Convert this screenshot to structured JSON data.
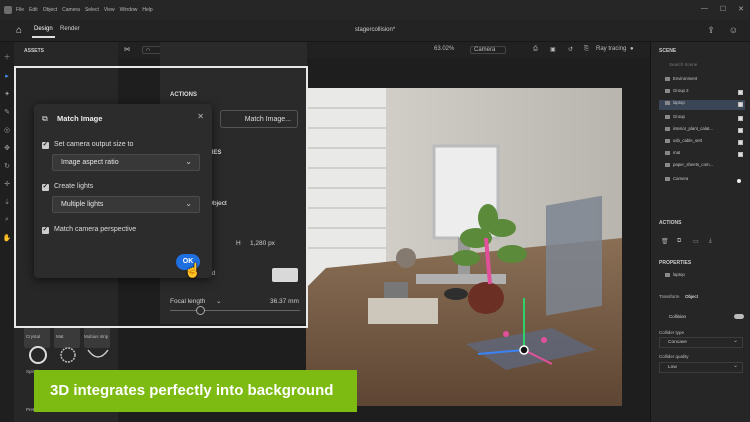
{
  "menubar": {
    "items": [
      "File",
      "Edit",
      "Object",
      "Camera",
      "Select",
      "View",
      "Window",
      "Help"
    ],
    "window_controls": [
      "—",
      "☐",
      "✕"
    ]
  },
  "topbar": {
    "tabs": [
      "Design",
      "Render"
    ],
    "doc_title": "stagercollision*",
    "right_icons": [
      "share-icon",
      "user-icon"
    ]
  },
  "assets": {
    "header": "ASSETS",
    "items": [
      "Crystal",
      "Mat",
      "Mobius strip",
      "Spiral",
      "Pretzel"
    ]
  },
  "viewport_bar": {
    "zoom": "63.02%",
    "camera": "Camera",
    "ray_tracing": "Ray tracing"
  },
  "properties": {
    "actions_header": "ACTIONS",
    "match_image_button": "Match Image...",
    "partial_header": "TIES",
    "object_tab": "Object",
    "height_label": "H",
    "height_value": "1,280 px",
    "partial_label": "nd",
    "focal_length_label": "Focal length",
    "focal_length_value": "36.37 mm"
  },
  "dialog": {
    "title": "Match Image",
    "set_camera_label": "Set camera output size to",
    "set_camera_value": "Image aspect ratio",
    "create_lights_label": "Create lights",
    "create_lights_value": "Multiple lights",
    "match_perspective_label": "Match camera perspective",
    "ok_label": "OK"
  },
  "scene": {
    "header": "SCENE",
    "search_placeholder": "Search Scene",
    "items": [
      {
        "label": "Environment",
        "selected": false
      },
      {
        "label": "Group 2",
        "selected": false
      },
      {
        "label": "laptop",
        "selected": true
      },
      {
        "label": "Group",
        "selected": false
      },
      {
        "label": "interior_plant_calat...",
        "selected": false
      },
      {
        "label": "usb_cable_sett",
        "selected": false
      },
      {
        "label": "mat",
        "selected": false
      },
      {
        "label": "paper_sheets_com...",
        "selected": false
      },
      {
        "label": "Camera",
        "selected": false
      }
    ],
    "actions_header": "ACTIONS",
    "properties_header": "PROPERTIES",
    "selected_object": "laptop",
    "transform_tab": "Transform",
    "object_tab": "Object",
    "collision_label": "Collision",
    "collider_type_label": "Collider type",
    "collider_type_value": "Concave",
    "collider_quality_label": "Collider quality",
    "collider_quality_value": "Low"
  },
  "caption": "3D integrates perfectly into background",
  "colors": {
    "accent": "#1f6fe0",
    "caption_bg": "#7dba12",
    "selection": "#3a4556"
  }
}
